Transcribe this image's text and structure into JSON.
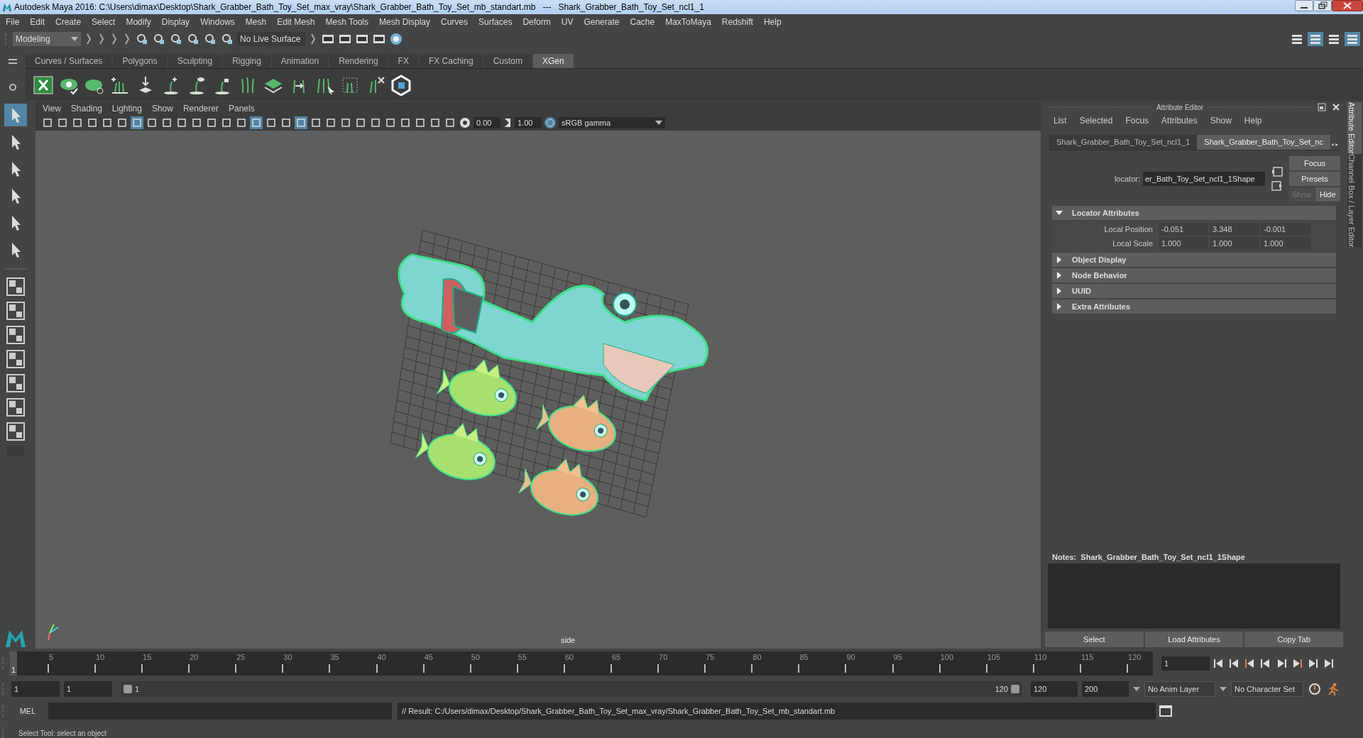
{
  "window": {
    "title": "Autodesk Maya 2016: C:\\Users\\dimax\\Desktop\\Shark_Grabber_Bath_Toy_Set_max_vray\\Shark_Grabber_Bath_Toy_Set_mb_standart.mb   ---   Shark_Grabber_Bath_Toy_Set_ncl1_1"
  },
  "menu_bar": [
    "File",
    "Edit",
    "Create",
    "Select",
    "Modify",
    "Display",
    "Windows",
    "Mesh",
    "Edit Mesh",
    "Mesh Tools",
    "Mesh Display",
    "Curves",
    "Surfaces",
    "Deform",
    "UV",
    "Generate",
    "Cache",
    "MaxToMaya",
    "Redshift",
    "Help"
  ],
  "status_line": {
    "mode": "Modeling",
    "live_surface": "No Live Surface"
  },
  "shelf": {
    "tabs": [
      {
        "label": "Curves / Surfaces",
        "selected": false
      },
      {
        "label": "Polygons",
        "selected": false
      },
      {
        "label": "Sculpting",
        "selected": false
      },
      {
        "label": "Rigging",
        "selected": false
      },
      {
        "label": "Animation",
        "selected": false
      },
      {
        "label": "Rendering",
        "selected": false
      },
      {
        "label": "FX",
        "selected": false
      },
      {
        "label": "FX Caching",
        "selected": false
      },
      {
        "label": "Custom",
        "selected": false
      },
      {
        "label": "XGen",
        "selected": true
      }
    ]
  },
  "viewport": {
    "menu": [
      "View",
      "Shading",
      "Lighting",
      "Show",
      "Renderer",
      "Panels"
    ],
    "exposure": "0.00",
    "gamma": "1.00",
    "color_space": "sRGB gamma",
    "camera_label": "side"
  },
  "attribute_editor": {
    "title": "Attribute Editor",
    "menu": [
      "List",
      "Selected",
      "Focus",
      "Attributes",
      "Show",
      "Help"
    ],
    "tabs": [
      {
        "label": "Shark_Grabber_Bath_Toy_Set_ncl1_1",
        "selected": false
      },
      {
        "label": "Shark_Grabber_Bath_Toy_Set_nc",
        "selected": true
      }
    ],
    "node_label": "locator:",
    "node_name": "er_Bath_Toy_Set_ncl1_1Shape",
    "buttons": [
      "Focus",
      "Presets"
    ],
    "show_hide": [
      {
        "label": "Show",
        "selected": false
      },
      {
        "label": "Hide",
        "selected": true
      }
    ],
    "sections": [
      {
        "title": "Locator Attributes",
        "expanded": true,
        "rows": [
          {
            "label": "Local Position",
            "values": [
              "-0.051",
              "3.348",
              "-0.001"
            ]
          },
          {
            "label": "Local Scale",
            "values": [
              "1.000",
              "1.000",
              "1.000"
            ]
          }
        ]
      },
      {
        "title": "Object Display",
        "expanded": false
      },
      {
        "title": "Node Behavior",
        "expanded": false
      },
      {
        "title": "UUID",
        "expanded": false
      },
      {
        "title": "Extra Attributes",
        "expanded": false
      }
    ],
    "notes": "Notes:  Shark_Grabber_Bath_Toy_Set_ncl1_1Shape",
    "bottom_buttons": [
      "Select",
      "Load Attributes",
      "Copy Tab"
    ]
  },
  "side_tabs": [
    {
      "label": "Attribute Editor",
      "selected": true
    },
    {
      "label": "Channel Box / Layer Editor",
      "selected": false
    }
  ],
  "timeline": {
    "current_frame": "1",
    "tick_labels": [
      "5",
      "10",
      "15",
      "20",
      "25",
      "30",
      "35",
      "40",
      "45",
      "50",
      "55",
      "60",
      "65",
      "70",
      "75",
      "80",
      "85",
      "90",
      "95",
      "100",
      "105",
      "110",
      "115",
      "120"
    ],
    "frame_field": "1"
  },
  "range": {
    "start": "1",
    "playback_start": "1",
    "slider_start": "1",
    "slider_end": "120",
    "playback_end": "120",
    "end": "200",
    "anim_layer": "No Anim Layer",
    "character_set": "No Character Set"
  },
  "command_line": {
    "language": "MEL",
    "result": "// Result: C:/Users/dimax/Desktop/Shark_Grabber_Bath_Toy_Set_max_vray/Shark_Grabber_Bath_Toy_Set_mb_standart.mb"
  },
  "help_line": "Select Tool: select an object"
}
